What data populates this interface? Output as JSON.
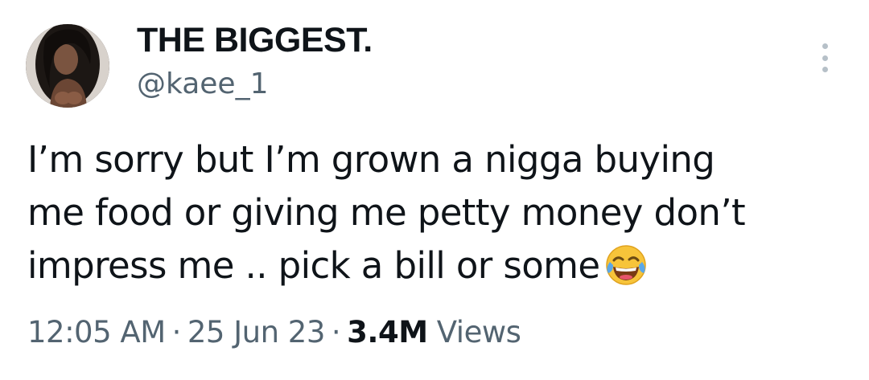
{
  "author": {
    "display_name": "THE BIGGEST.",
    "handle": "@kaee_1"
  },
  "tweet": {
    "text_lines": [
      "I’m sorry but I’m grown a nigga buying",
      "me food or giving me petty money don’t",
      "impress me .. pick a bill or some"
    ],
    "emoji": "face-with-tears-of-joy-icon"
  },
  "meta": {
    "time": "12:05 AM",
    "separator": "·",
    "date": "25 Jun 23",
    "views_count": "3.4M",
    "views_label": "Views"
  },
  "colors": {
    "text": "#0f1419",
    "secondary": "#536471",
    "more_dots": "#b6c0c8"
  }
}
